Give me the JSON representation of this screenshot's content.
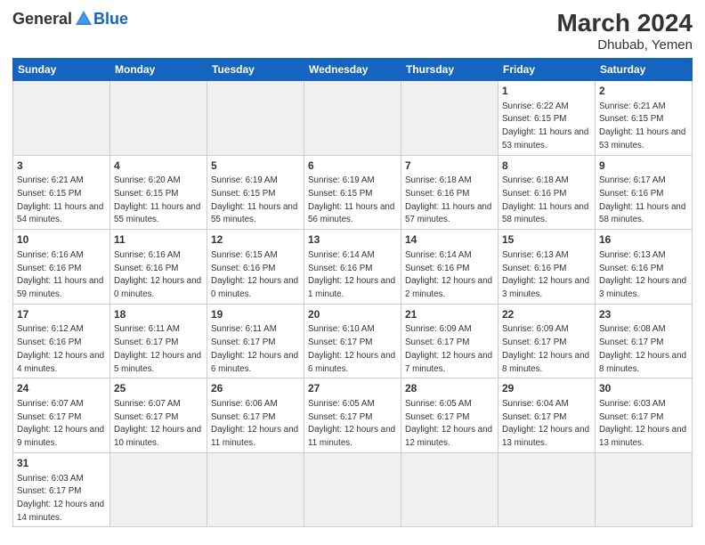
{
  "header": {
    "logo_general": "General",
    "logo_blue": "Blue",
    "month_year": "March 2024",
    "location": "Dhubab, Yemen"
  },
  "weekdays": [
    "Sunday",
    "Monday",
    "Tuesday",
    "Wednesday",
    "Thursday",
    "Friday",
    "Saturday"
  ],
  "weeks": [
    [
      {
        "day": "",
        "empty": true
      },
      {
        "day": "",
        "empty": true
      },
      {
        "day": "",
        "empty": true
      },
      {
        "day": "",
        "empty": true
      },
      {
        "day": "",
        "empty": true
      },
      {
        "day": "1",
        "sunrise": "6:22 AM",
        "sunset": "6:15 PM",
        "daylight": "11 hours and 53 minutes."
      },
      {
        "day": "2",
        "sunrise": "6:21 AM",
        "sunset": "6:15 PM",
        "daylight": "11 hours and 53 minutes."
      }
    ],
    [
      {
        "day": "3",
        "sunrise": "6:21 AM",
        "sunset": "6:15 PM",
        "daylight": "11 hours and 54 minutes."
      },
      {
        "day": "4",
        "sunrise": "6:20 AM",
        "sunset": "6:15 PM",
        "daylight": "11 hours and 55 minutes."
      },
      {
        "day": "5",
        "sunrise": "6:19 AM",
        "sunset": "6:15 PM",
        "daylight": "11 hours and 55 minutes."
      },
      {
        "day": "6",
        "sunrise": "6:19 AM",
        "sunset": "6:15 PM",
        "daylight": "11 hours and 56 minutes."
      },
      {
        "day": "7",
        "sunrise": "6:18 AM",
        "sunset": "6:16 PM",
        "daylight": "11 hours and 57 minutes."
      },
      {
        "day": "8",
        "sunrise": "6:18 AM",
        "sunset": "6:16 PM",
        "daylight": "11 hours and 58 minutes."
      },
      {
        "day": "9",
        "sunrise": "6:17 AM",
        "sunset": "6:16 PM",
        "daylight": "11 hours and 58 minutes."
      }
    ],
    [
      {
        "day": "10",
        "sunrise": "6:16 AM",
        "sunset": "6:16 PM",
        "daylight": "11 hours and 59 minutes."
      },
      {
        "day": "11",
        "sunrise": "6:16 AM",
        "sunset": "6:16 PM",
        "daylight": "12 hours and 0 minutes."
      },
      {
        "day": "12",
        "sunrise": "6:15 AM",
        "sunset": "6:16 PM",
        "daylight": "12 hours and 0 minutes."
      },
      {
        "day": "13",
        "sunrise": "6:14 AM",
        "sunset": "6:16 PM",
        "daylight": "12 hours and 1 minute."
      },
      {
        "day": "14",
        "sunrise": "6:14 AM",
        "sunset": "6:16 PM",
        "daylight": "12 hours and 2 minutes."
      },
      {
        "day": "15",
        "sunrise": "6:13 AM",
        "sunset": "6:16 PM",
        "daylight": "12 hours and 3 minutes."
      },
      {
        "day": "16",
        "sunrise": "6:13 AM",
        "sunset": "6:16 PM",
        "daylight": "12 hours and 3 minutes."
      }
    ],
    [
      {
        "day": "17",
        "sunrise": "6:12 AM",
        "sunset": "6:16 PM",
        "daylight": "12 hours and 4 minutes."
      },
      {
        "day": "18",
        "sunrise": "6:11 AM",
        "sunset": "6:17 PM",
        "daylight": "12 hours and 5 minutes."
      },
      {
        "day": "19",
        "sunrise": "6:11 AM",
        "sunset": "6:17 PM",
        "daylight": "12 hours and 6 minutes."
      },
      {
        "day": "20",
        "sunrise": "6:10 AM",
        "sunset": "6:17 PM",
        "daylight": "12 hours and 6 minutes."
      },
      {
        "day": "21",
        "sunrise": "6:09 AM",
        "sunset": "6:17 PM",
        "daylight": "12 hours and 7 minutes."
      },
      {
        "day": "22",
        "sunrise": "6:09 AM",
        "sunset": "6:17 PM",
        "daylight": "12 hours and 8 minutes."
      },
      {
        "day": "23",
        "sunrise": "6:08 AM",
        "sunset": "6:17 PM",
        "daylight": "12 hours and 8 minutes."
      }
    ],
    [
      {
        "day": "24",
        "sunrise": "6:07 AM",
        "sunset": "6:17 PM",
        "daylight": "12 hours and 9 minutes."
      },
      {
        "day": "25",
        "sunrise": "6:07 AM",
        "sunset": "6:17 PM",
        "daylight": "12 hours and 10 minutes."
      },
      {
        "day": "26",
        "sunrise": "6:06 AM",
        "sunset": "6:17 PM",
        "daylight": "12 hours and 11 minutes."
      },
      {
        "day": "27",
        "sunrise": "6:05 AM",
        "sunset": "6:17 PM",
        "daylight": "12 hours and 11 minutes."
      },
      {
        "day": "28",
        "sunrise": "6:05 AM",
        "sunset": "6:17 PM",
        "daylight": "12 hours and 12 minutes."
      },
      {
        "day": "29",
        "sunrise": "6:04 AM",
        "sunset": "6:17 PM",
        "daylight": "12 hours and 13 minutes."
      },
      {
        "day": "30",
        "sunrise": "6:03 AM",
        "sunset": "6:17 PM",
        "daylight": "12 hours and 13 minutes."
      }
    ],
    [
      {
        "day": "31",
        "sunrise": "6:03 AM",
        "sunset": "6:17 PM",
        "daylight": "12 hours and 14 minutes."
      },
      {
        "day": "",
        "empty": true
      },
      {
        "day": "",
        "empty": true
      },
      {
        "day": "",
        "empty": true
      },
      {
        "day": "",
        "empty": true
      },
      {
        "day": "",
        "empty": true
      },
      {
        "day": "",
        "empty": true
      }
    ]
  ]
}
